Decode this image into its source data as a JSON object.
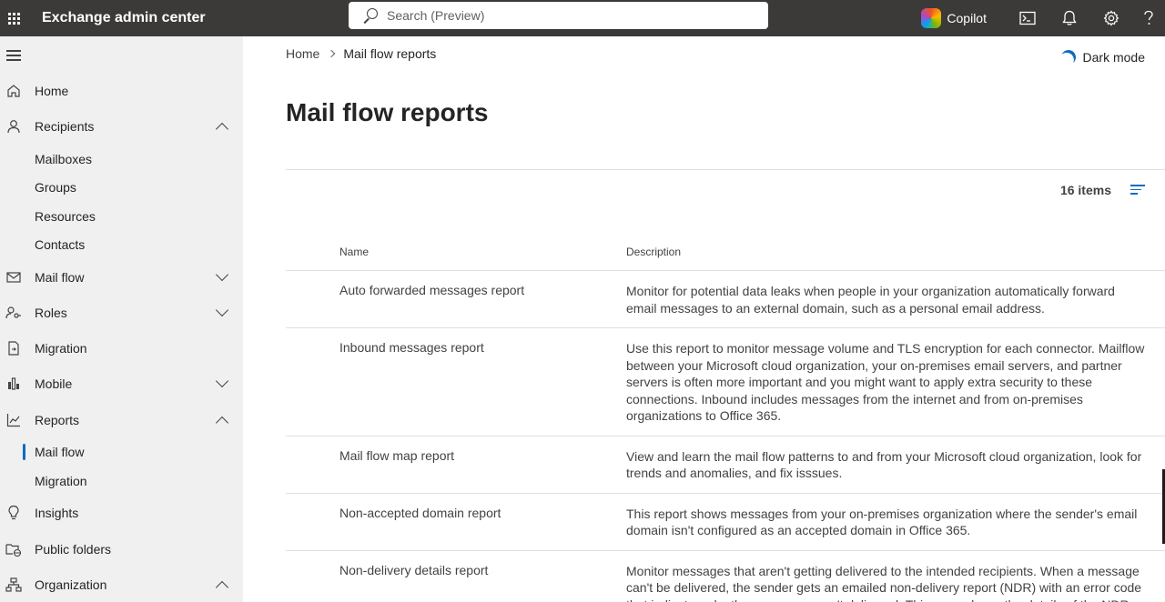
{
  "topbar": {
    "app_title": "Exchange admin center",
    "search_placeholder": "Search (Preview)",
    "copilot_label": "Copilot"
  },
  "sidebar": {
    "items": [
      {
        "label": "Home"
      },
      {
        "label": "Recipients"
      },
      {
        "label": "Mail flow"
      },
      {
        "label": "Roles"
      },
      {
        "label": "Migration"
      },
      {
        "label": "Mobile"
      },
      {
        "label": "Reports"
      },
      {
        "label": "Insights"
      },
      {
        "label": "Public folders"
      },
      {
        "label": "Organization"
      }
    ],
    "recipients_sub": [
      "Mailboxes",
      "Groups",
      "Resources",
      "Contacts"
    ],
    "reports_sub": [
      "Mail flow",
      "Migration"
    ]
  },
  "breadcrumb": {
    "home": "Home",
    "current": "Mail flow reports"
  },
  "dark_mode_label": "Dark mode",
  "page_title": "Mail flow reports",
  "items_count": "16 items",
  "table": {
    "headers": {
      "name": "Name",
      "description": "Description"
    },
    "rows": [
      {
        "name": "Auto forwarded messages report",
        "description": "Monitor for potential data leaks when people in your organization automatically forward email messages to an external domain, such as a personal email address."
      },
      {
        "name": "Inbound messages report",
        "description": "Use this report to monitor message volume and TLS encryption for each connector. Mailflow between your Microsoft cloud organization, your on-premises email servers, and partner servers is often more important and you might want to apply extra security to these connections. Inbound includes messages from the internet and from on-premises organizations to Office 365."
      },
      {
        "name": "Mail flow map report",
        "description": "View and learn the mail flow patterns to and from your Microsoft cloud organization, look for trends and anomalies, and fix isssues."
      },
      {
        "name": "Non-accepted domain report",
        "description": "This report shows messages from your on-premises organization where the sender's email domain isn't configured as an accepted domain in Office 365."
      },
      {
        "name": "Non-delivery details report",
        "description": "Monitor messages that aren't getting delivered to the intended recipients. When a message can't be delivered, the sender gets an emailed non-delivery report (NDR) with an error code that indicates why the message wasn't delivered. This page shows the details of the NDRs"
      }
    ]
  }
}
